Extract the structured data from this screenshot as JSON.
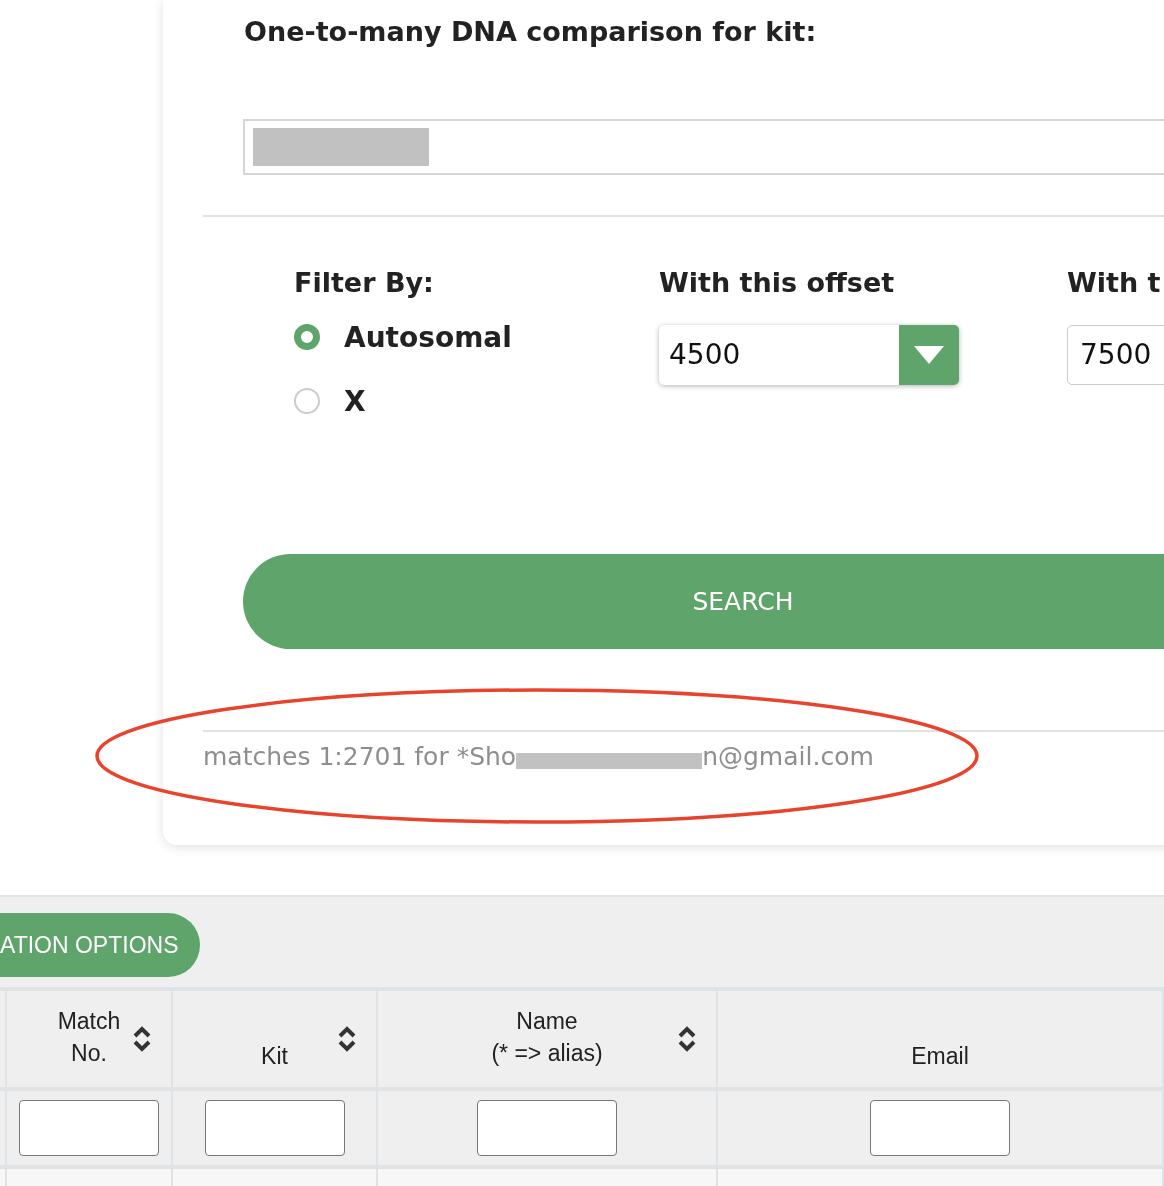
{
  "search_form": {
    "title": "One-to-many DNA comparison for kit:",
    "kit_field": {
      "redacted": true
    },
    "filter_by": {
      "label": "Filter By:",
      "options": [
        {
          "label": "Autosomal",
          "selected": true
        },
        {
          "label": "X",
          "selected": false
        }
      ]
    },
    "offset": {
      "label": "With this offset",
      "value": "4500"
    },
    "column_3": {
      "label": "With t",
      "value": "7500"
    },
    "search_button": "SEARCH",
    "result": {
      "prefix": "matches 1:2701 for *Sho",
      "redacted": true,
      "suffix": "n@gmail.com"
    }
  },
  "table": {
    "options_button": "ATION OPTIONS",
    "columns": [
      {
        "label": [
          "Match",
          "No."
        ],
        "sortable": true
      },
      {
        "label": [
          "Kit"
        ],
        "sortable": true
      },
      {
        "label": [
          "Name",
          "(* => alias)"
        ],
        "sortable": true
      },
      {
        "label": [
          "Email"
        ],
        "sortable": false
      }
    ]
  }
}
